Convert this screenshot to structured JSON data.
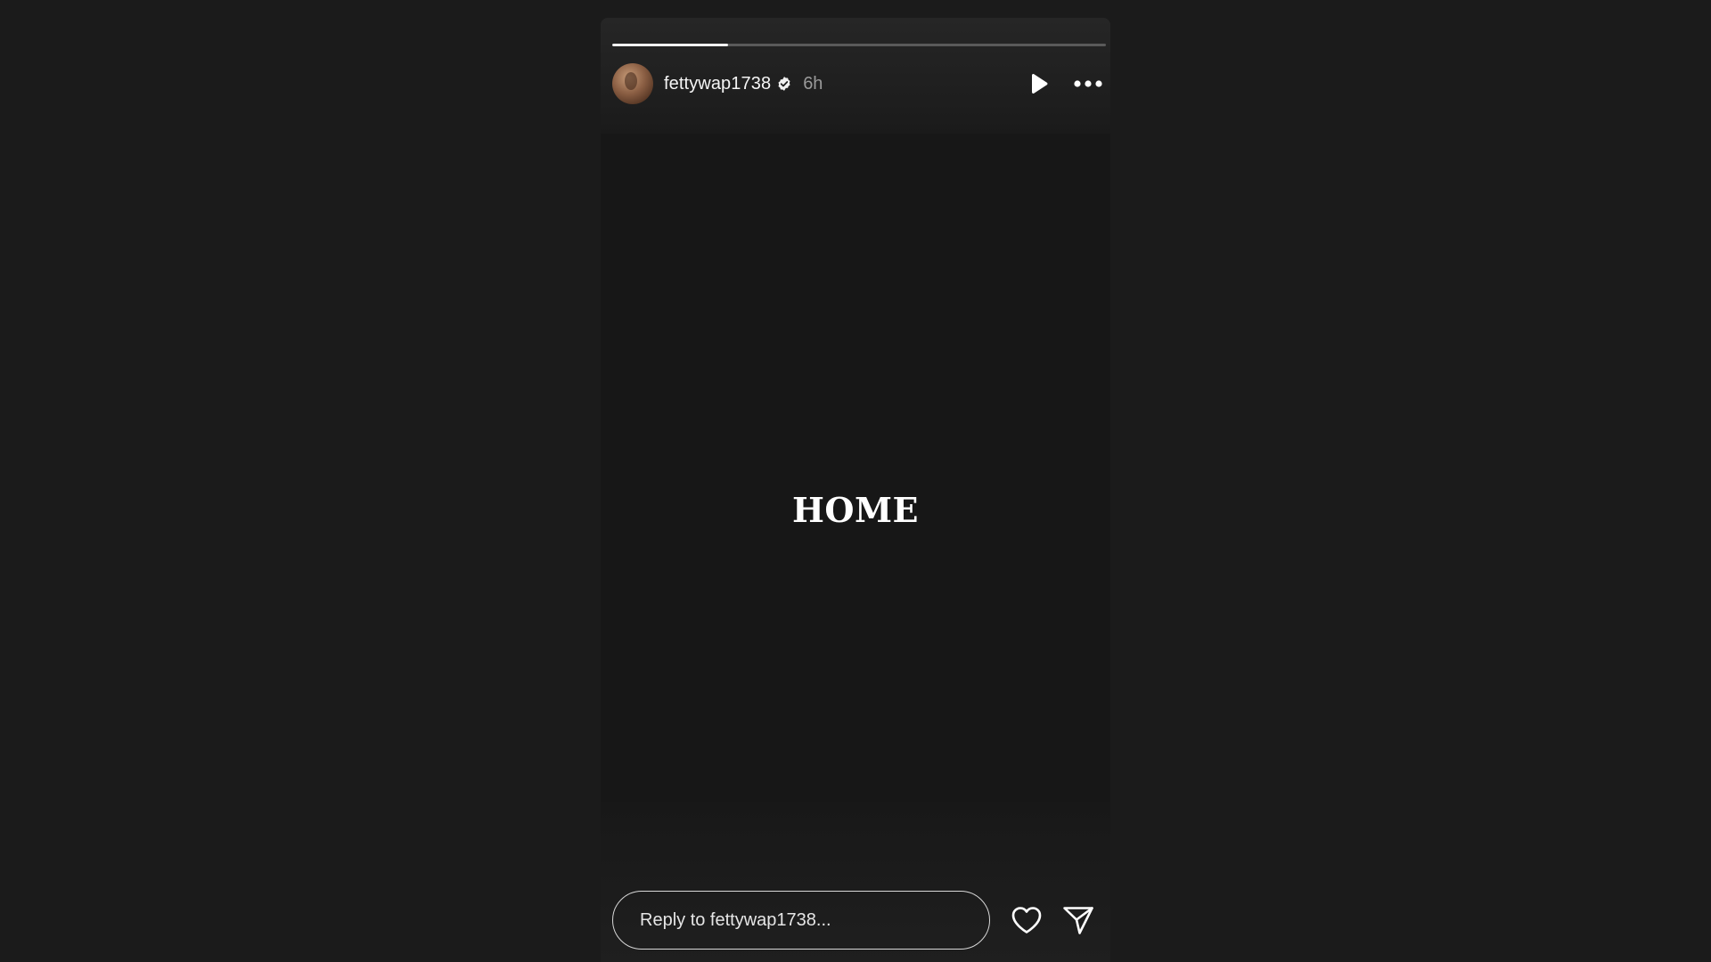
{
  "story": {
    "progress_fraction": 0.235,
    "username": "fettywap1738",
    "verified": true,
    "time_ago": "6h",
    "text": "HOME"
  },
  "icons": {
    "verified": "verified-badge-icon",
    "play": "play-icon",
    "more": "more-options-icon",
    "like": "heart-icon",
    "share": "send-icon"
  },
  "reply": {
    "placeholder": "Reply to fettywap1738..."
  },
  "colors": {
    "page_background": "#1b1b1b",
    "story_background": "#1a1a1a",
    "progress_active": "#f2f2f2",
    "progress_inactive": "#5a5a5a",
    "text_primary": "#f5f5f5",
    "text_secondary": "#9a9a9a"
  }
}
